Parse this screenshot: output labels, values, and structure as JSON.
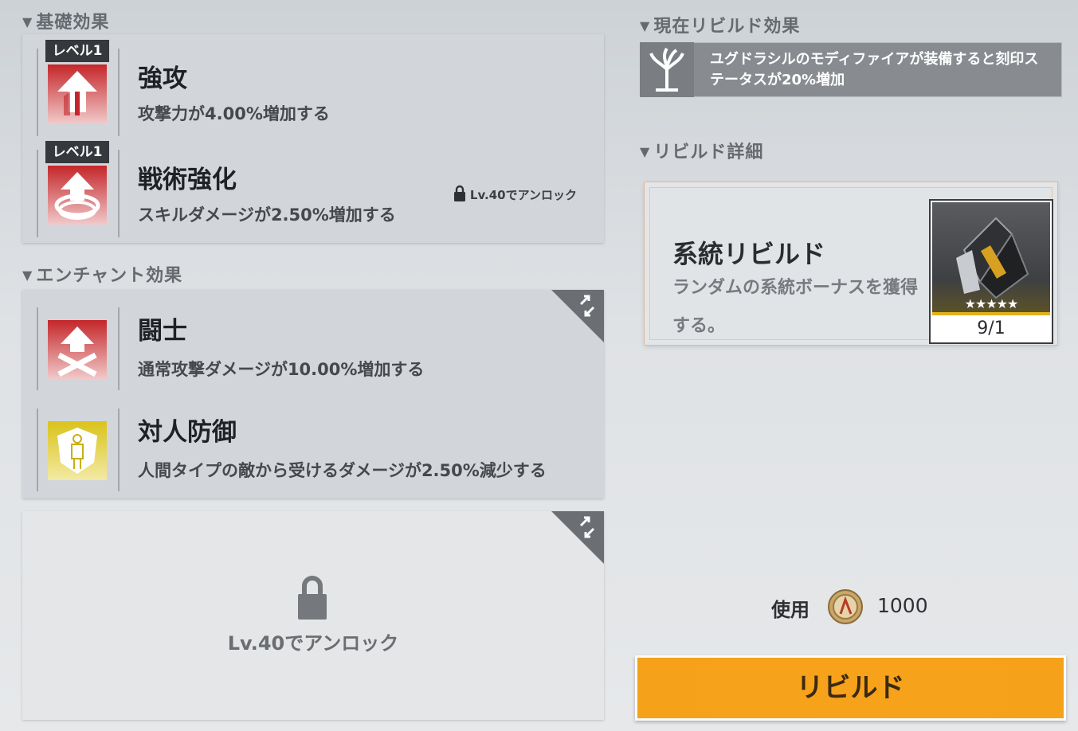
{
  "left": {
    "basic": {
      "title": "基礎効果",
      "rows": [
        {
          "level": "レベル1",
          "name": "強攻",
          "desc": "攻撃力が4.00%増加する",
          "icon": "attack-up-icon"
        },
        {
          "level": "レベル1",
          "name": "戦術強化",
          "desc": "スキルダメージが2.50%増加する",
          "icon": "skill-damage-icon",
          "lock_note": "Lv.40でアンロック"
        }
      ]
    },
    "enchant": {
      "title": "エンチャント効果",
      "rows": [
        {
          "name": "闘士",
          "desc": "通常攻撃ダメージが10.00%増加する",
          "icon": "fighter-icon"
        },
        {
          "name": "対人防御",
          "desc": "人間タイプの敵から受けるダメージが2.50%減少する",
          "icon": "human-defense-icon"
        }
      ]
    },
    "locked_slot": {
      "text": "Lv.40でアンロック"
    }
  },
  "right": {
    "current": {
      "title": "現在リビルド効果",
      "text": "ユグドラシルのモディファイアが装備すると刻印ステータスが20%増加"
    },
    "detail": {
      "title": "リビルド詳細",
      "card_title": "系統リビルド",
      "card_desc": "ランダムの系統ボーナスを獲得する。",
      "stars": "★★★★★",
      "quantity": "9/1"
    },
    "cost": {
      "label": "使用",
      "value": "1000"
    },
    "button": {
      "label": "リビルド"
    }
  },
  "colors": {
    "accent": "#f5a11a",
    "panel": "#d2d6da",
    "dark": "#35383c"
  }
}
